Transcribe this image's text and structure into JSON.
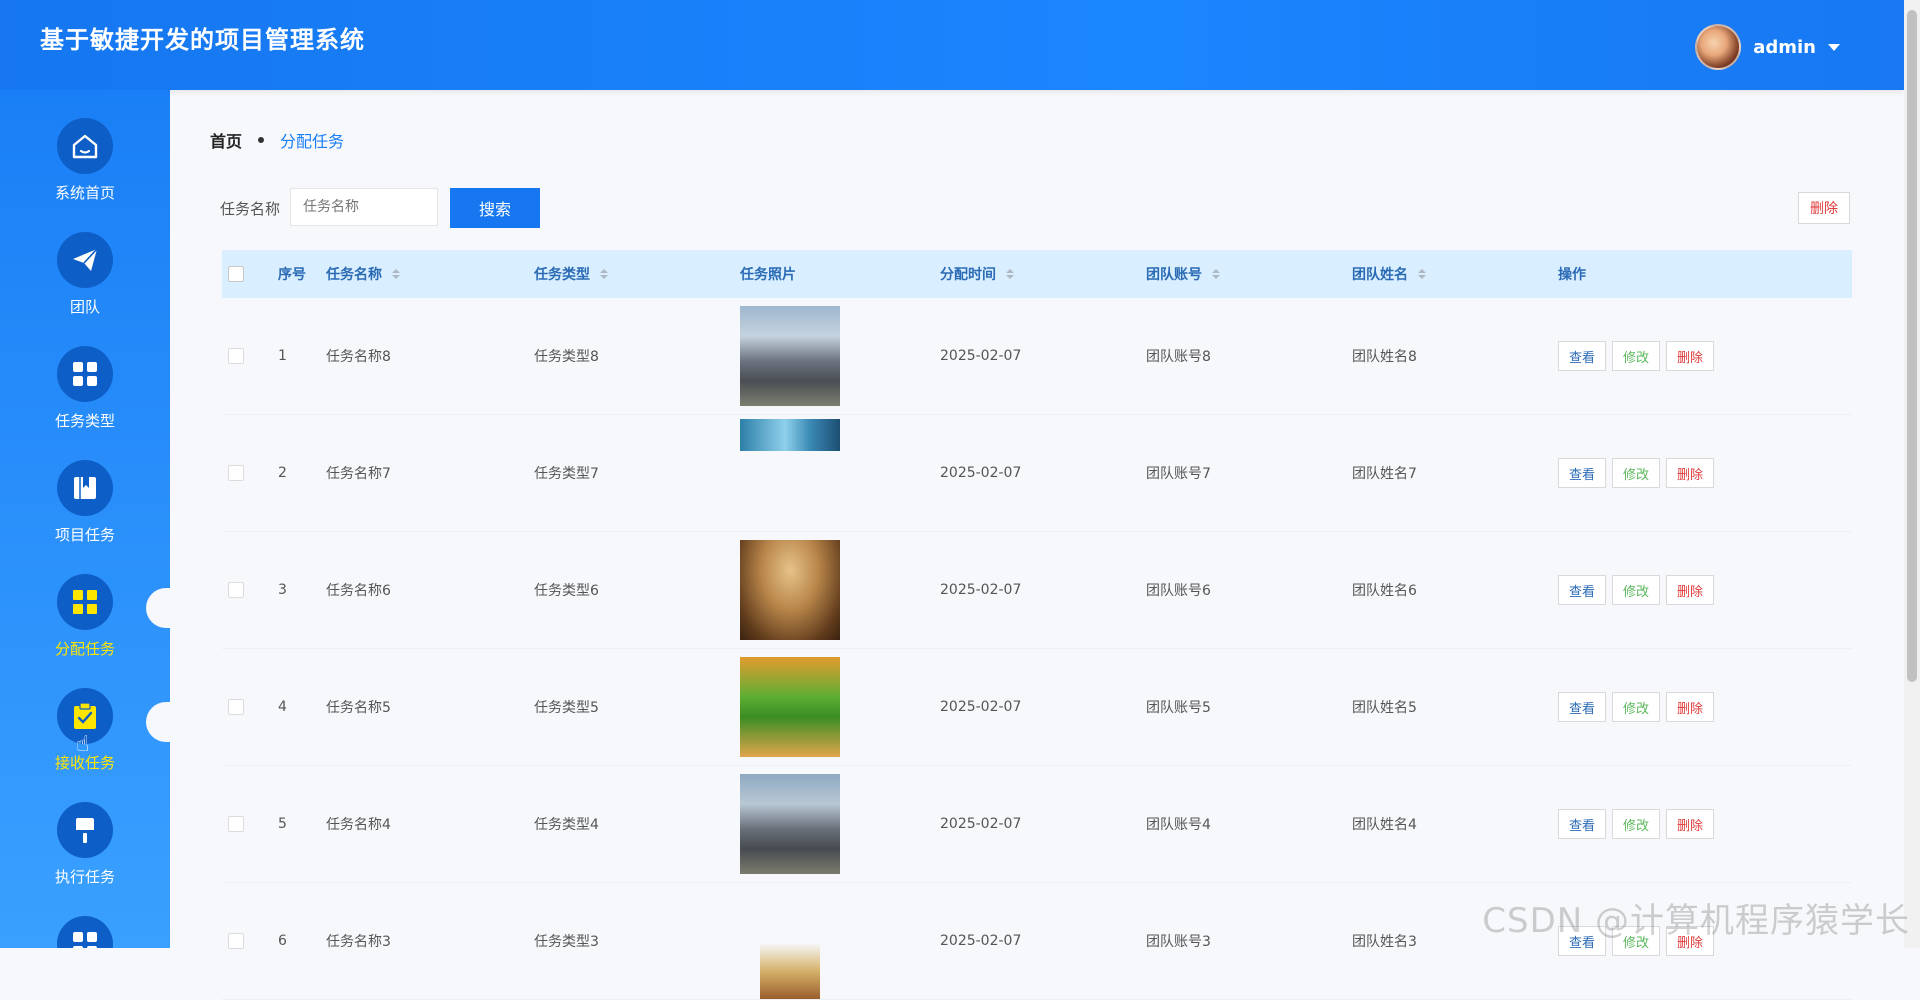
{
  "header": {
    "title": "基于敏捷开发的项目管理系统",
    "user": "admin"
  },
  "sidebar": {
    "items": [
      {
        "label": "系统首页",
        "icon": "home-icon"
      },
      {
        "label": "团队",
        "icon": "paper-plane-icon"
      },
      {
        "label": "任务类型",
        "icon": "grid-icon"
      },
      {
        "label": "项目任务",
        "icon": "book-icon"
      },
      {
        "label": "分配任务",
        "icon": "grid-icon",
        "active": true
      },
      {
        "label": "接收任务",
        "icon": "clipboard-check-icon",
        "active": true
      },
      {
        "label": "执行任务",
        "icon": "brush-icon"
      }
    ]
  },
  "breadcrumb": {
    "home": "首页",
    "current": "分配任务"
  },
  "search": {
    "label": "任务名称",
    "placeholder": "任务名称",
    "button": "搜索"
  },
  "toolbar": {
    "delete": "删除"
  },
  "table": {
    "headers": {
      "no": "序号",
      "name": "任务名称",
      "type": "任务类型",
      "photo": "任务照片",
      "time": "分配时间",
      "account": "团队账号",
      "team": "团队姓名",
      "ops": "操作"
    },
    "actions": {
      "view": "查看",
      "edit": "修改",
      "delete": "删除"
    },
    "rows": [
      {
        "no": "1",
        "name": "任务名称8",
        "type": "任务类型8",
        "time": "2025-02-07",
        "account": "团队账号8",
        "team": "团队姓名8"
      },
      {
        "no": "2",
        "name": "任务名称7",
        "type": "任务类型7",
        "time": "2025-02-07",
        "account": "团队账号7",
        "team": "团队姓名7"
      },
      {
        "no": "3",
        "name": "任务名称6",
        "type": "任务类型6",
        "time": "2025-02-07",
        "account": "团队账号6",
        "team": "团队姓名6"
      },
      {
        "no": "4",
        "name": "任务名称5",
        "type": "任务类型5",
        "time": "2025-02-07",
        "account": "团队账号5",
        "team": "团队姓名5"
      },
      {
        "no": "5",
        "name": "任务名称4",
        "type": "任务类型4",
        "time": "2025-02-07",
        "account": "团队账号4",
        "team": "团队姓名4"
      },
      {
        "no": "6",
        "name": "任务名称3",
        "type": "任务类型3",
        "time": "2025-02-07",
        "account": "团队账号3",
        "team": "团队姓名3"
      }
    ]
  },
  "watermark": "CSDN @计算机程序猿学长"
}
